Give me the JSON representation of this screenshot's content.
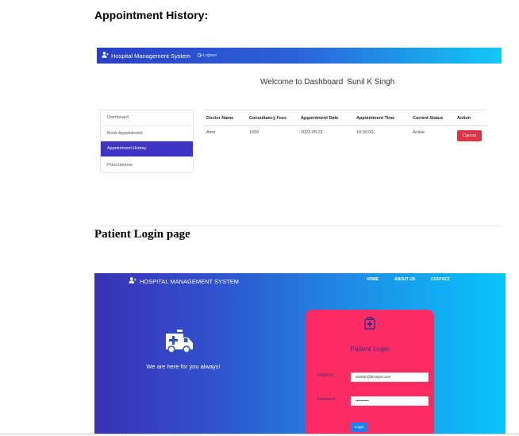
{
  "headings": {
    "appointment_history": "Appointment History:",
    "patient_login_page": "Patient Login page"
  },
  "dashboard_screenshot": {
    "navbar": {
      "brand": "Hospital Management System",
      "brand_icon": "user-md-icon",
      "logout": "Logout",
      "logout_icon": "logout-icon"
    },
    "welcome_text": "Welcome to Dashboard",
    "user_name": "Sunil K Singh",
    "sidebar": {
      "items": [
        {
          "label": "Dashboard",
          "active": false
        },
        {
          "label": "Book Appointment",
          "active": false
        },
        {
          "label": "Appointment History",
          "active": true
        },
        {
          "label": "Prescriptions",
          "active": false
        }
      ],
      "active_color": "#3f33c6"
    },
    "table": {
      "headers": [
        "Doctor Name",
        "Consultancy Fees",
        "Appointment Date",
        "Appointment Time",
        "Current Status",
        "Action"
      ],
      "rows": [
        {
          "doctor": "Amit",
          "fees": "1000",
          "date": "2022-05-31",
          "time": "10:00:00",
          "status": "Active",
          "action": "Cancel"
        }
      ],
      "cancel_color": "#dc3545"
    }
  },
  "login_screenshot": {
    "brand": "HOSPITAL MANAGEMENT SYSTEM",
    "brand_icon": "user-md-icon",
    "nav": {
      "home": "HOME",
      "about": "ABOUT US",
      "contact": "CONTACT"
    },
    "hero_icon": "ambulance-icon",
    "tagline": "We are here for you always!",
    "card": {
      "icon": "clinic-icon",
      "title": "Patient Login",
      "email_label": "Email ID",
      "email_value": "shishir@droisys.com",
      "password_label": "Password",
      "password_value": "••••••••••",
      "login_button": "Login",
      "card_color": "#fb2c64",
      "button_color": "#1d7ff0"
    }
  }
}
